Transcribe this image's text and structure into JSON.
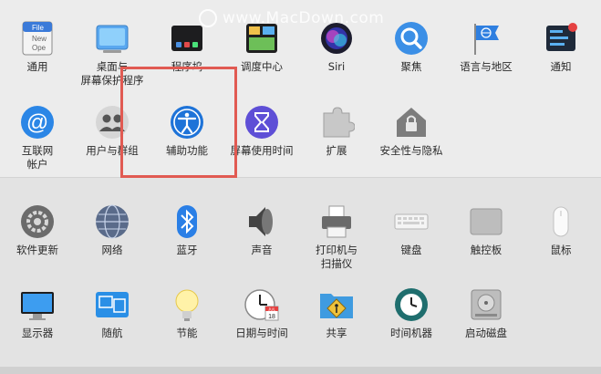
{
  "watermark": {
    "text": "www.MacDown.com"
  },
  "top_row1": [
    {
      "name": "general",
      "label": "通用",
      "icon": "general-icon"
    },
    {
      "name": "desktop",
      "label": "桌面与\n屏幕保护程序",
      "icon": "desktop-icon"
    },
    {
      "name": "dock",
      "label": "程序坞",
      "icon": "dock-icon"
    },
    {
      "name": "mission-control",
      "label": "调度中心",
      "icon": "mission-control-icon"
    },
    {
      "name": "siri",
      "label": "Siri",
      "icon": "siri-icon"
    },
    {
      "name": "spotlight",
      "label": "聚焦",
      "icon": "spotlight-icon"
    },
    {
      "name": "language",
      "label": "语言与地区",
      "icon": "language-icon"
    },
    {
      "name": "notifications",
      "label": "通知",
      "icon": "notifications-icon"
    }
  ],
  "top_row2": [
    {
      "name": "internet-accounts",
      "label": "互联网\n帐户",
      "icon": "internet-accounts-icon"
    },
    {
      "name": "users-groups",
      "label": "用户与群组",
      "icon": "users-groups-icon"
    },
    {
      "name": "accessibility",
      "label": "辅助功能",
      "icon": "accessibility-icon"
    },
    {
      "name": "screen-time",
      "label": "屏幕使用时间",
      "icon": "screen-time-icon"
    },
    {
      "name": "extensions",
      "label": "扩展",
      "icon": "extensions-icon"
    },
    {
      "name": "security",
      "label": "安全性与隐私",
      "icon": "security-icon"
    }
  ],
  "bottom_row1": [
    {
      "name": "software-update",
      "label": "软件更新",
      "icon": "software-update-icon"
    },
    {
      "name": "network",
      "label": "网络",
      "icon": "network-icon"
    },
    {
      "name": "bluetooth",
      "label": "蓝牙",
      "icon": "bluetooth-icon"
    },
    {
      "name": "sound",
      "label": "声音",
      "icon": "sound-icon"
    },
    {
      "name": "printers",
      "label": "打印机与\n扫描仪",
      "icon": "printer-icon"
    },
    {
      "name": "keyboard",
      "label": "键盘",
      "icon": "keyboard-icon"
    },
    {
      "name": "trackpad",
      "label": "触控板",
      "icon": "trackpad-icon"
    },
    {
      "name": "mouse",
      "label": "鼠标",
      "icon": "mouse-icon"
    }
  ],
  "bottom_row2": [
    {
      "name": "displays",
      "label": "显示器",
      "icon": "display-icon"
    },
    {
      "name": "sidecar",
      "label": "随航",
      "icon": "sidecar-icon"
    },
    {
      "name": "energy",
      "label": "节能",
      "icon": "energy-icon"
    },
    {
      "name": "date-time",
      "label": "日期与时间",
      "icon": "clock-icon"
    },
    {
      "name": "sharing",
      "label": "共享",
      "icon": "sharing-icon"
    },
    {
      "name": "time-machine",
      "label": "时间机器",
      "icon": "time-machine-icon"
    },
    {
      "name": "startup-disk",
      "label": "启动磁盘",
      "icon": "startup-disk-icon"
    }
  ],
  "icon_texts": {
    "general_file": "File",
    "general_new": "New",
    "general_ope": "Ope",
    "calendar_jul": "JUL",
    "calendar_day": "18"
  },
  "colors": {
    "highlight": "#e15a52",
    "accent": "#1e73d8"
  }
}
